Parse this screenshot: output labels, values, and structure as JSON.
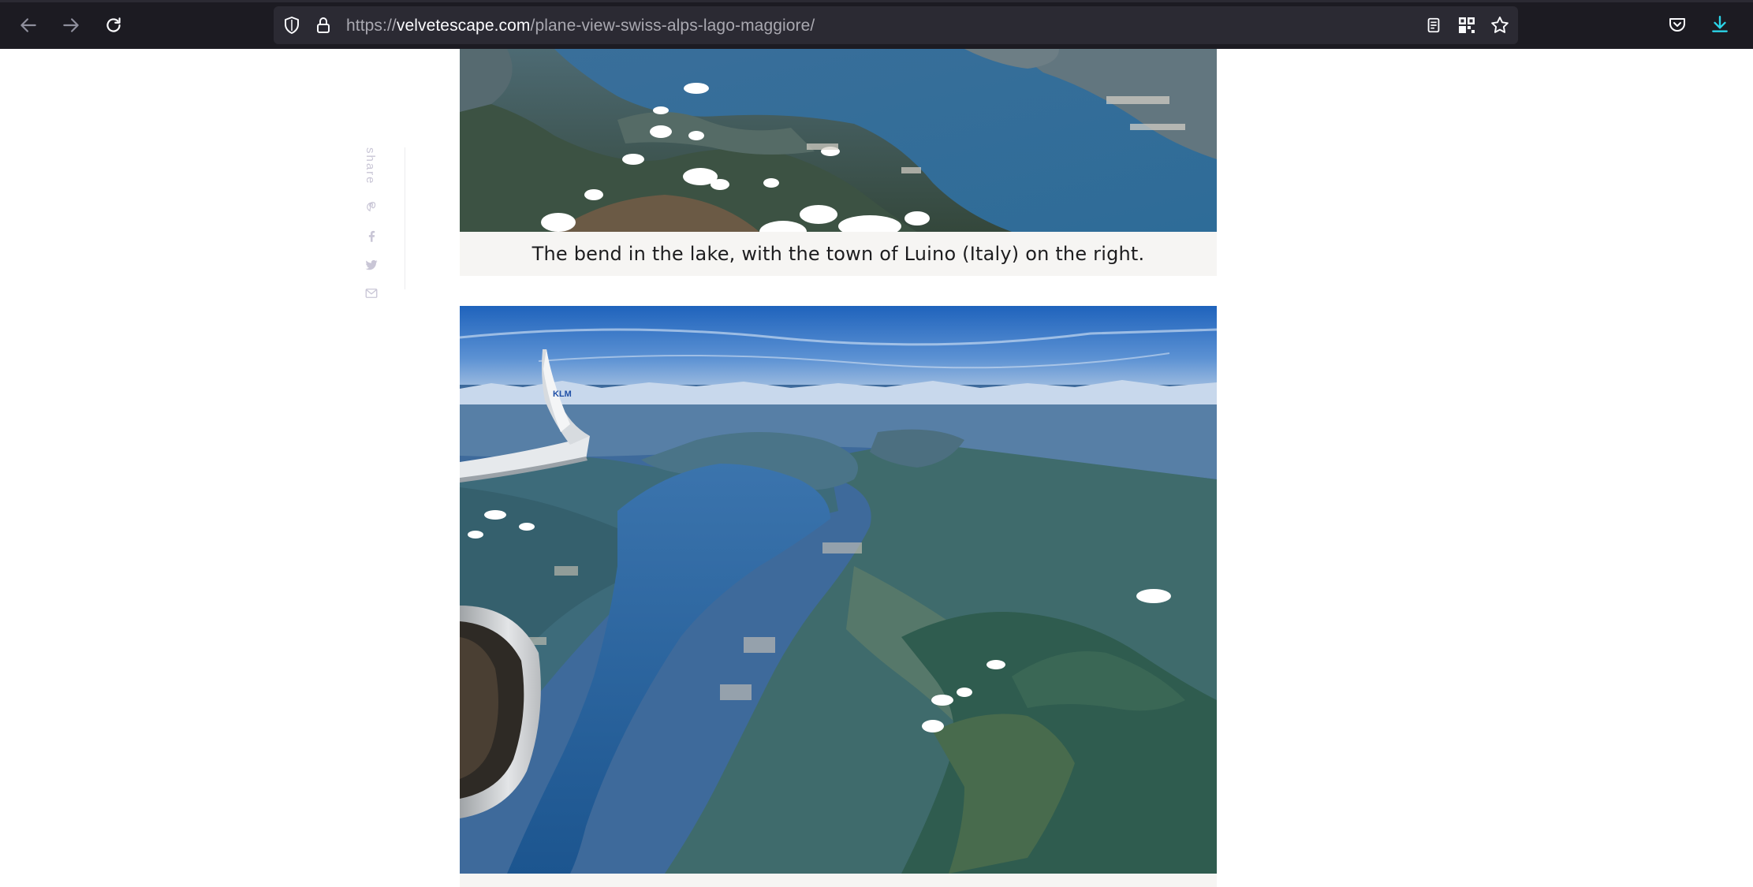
{
  "browser": {
    "url_scheme": "https://",
    "url_host": "velvetescape.com",
    "url_path": "/plane-view-swiss-alps-lago-maggiore/",
    "icons": {
      "back": "arrow-left-icon",
      "forward": "arrow-right-icon",
      "reload": "reload-icon",
      "tracking": "shield-icon",
      "security": "lock-icon",
      "reader": "reader-view-icon",
      "qr": "qr-code-icon",
      "bookmark": "star-icon",
      "pocket": "pocket-icon",
      "downloads": "download-icon"
    },
    "colors": {
      "chrome_bg": "#1c1b22",
      "urlbar_bg": "#2b2a33",
      "download_accent": "#54ffbd"
    }
  },
  "share": {
    "label": "share",
    "items": [
      {
        "icon": "pinterest-icon"
      },
      {
        "icon": "facebook-icon"
      },
      {
        "icon": "twitter-icon"
      },
      {
        "icon": "email-icon"
      }
    ]
  },
  "article": {
    "images": [
      {
        "caption": "The bend in the lake, with the town of Luino (Italy) on the right."
      },
      {
        "caption": "",
        "tail_logo": "KLM"
      }
    ]
  }
}
